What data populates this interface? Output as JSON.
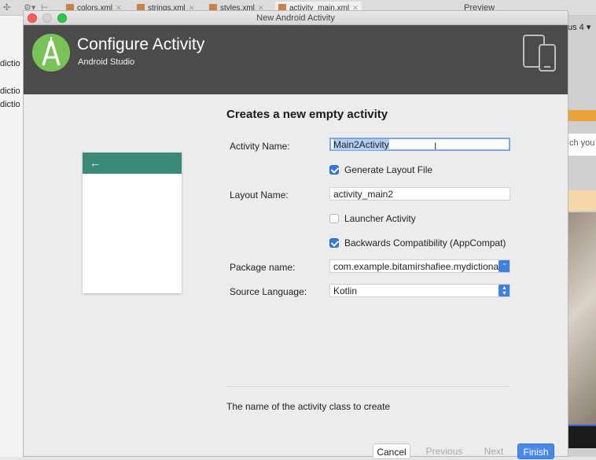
{
  "ide": {
    "tabs": [
      {
        "label": "colors.xml"
      },
      {
        "label": "strings.xml"
      },
      {
        "label": "styles.xml"
      },
      {
        "label": "activity_main.xml"
      }
    ],
    "preview_label": "Preview",
    "left_snippets": [
      "dictio",
      "dictio",
      "dictio"
    ],
    "right_device_label": "us 4 ▾",
    "right_search_hint": "ch you"
  },
  "dialog": {
    "window_title": "New Android Activity",
    "header_title": "Configure Activity",
    "header_subtitle": "Android Studio",
    "form_title": "Creates a new empty activity",
    "activity_name_label": "Activity Name:",
    "activity_name_value": "Main2Activity",
    "generate_layout_label": "Generate Layout File",
    "generate_layout_checked": true,
    "layout_name_label": "Layout Name:",
    "layout_name_value": "activity_main2",
    "launcher_label": "Launcher Activity",
    "launcher_checked": false,
    "backcompat_label": "Backwards Compatibility (AppCompat)",
    "backcompat_checked": true,
    "package_label": "Package name:",
    "package_value": "com.example.bitamirshafiee.mydictiona",
    "language_label": "Source Language:",
    "language_value": "Kotlin",
    "hint": "The name of the activity class to create",
    "buttons": {
      "cancel": "Cancel",
      "previous": "Previous",
      "next": "Next",
      "finish": "Finish"
    }
  },
  "colors": {
    "header_bg": "#4b4b4b",
    "accent": "#3478dc",
    "preview_bar": "#3b8a78",
    "logo": "#78c257"
  }
}
